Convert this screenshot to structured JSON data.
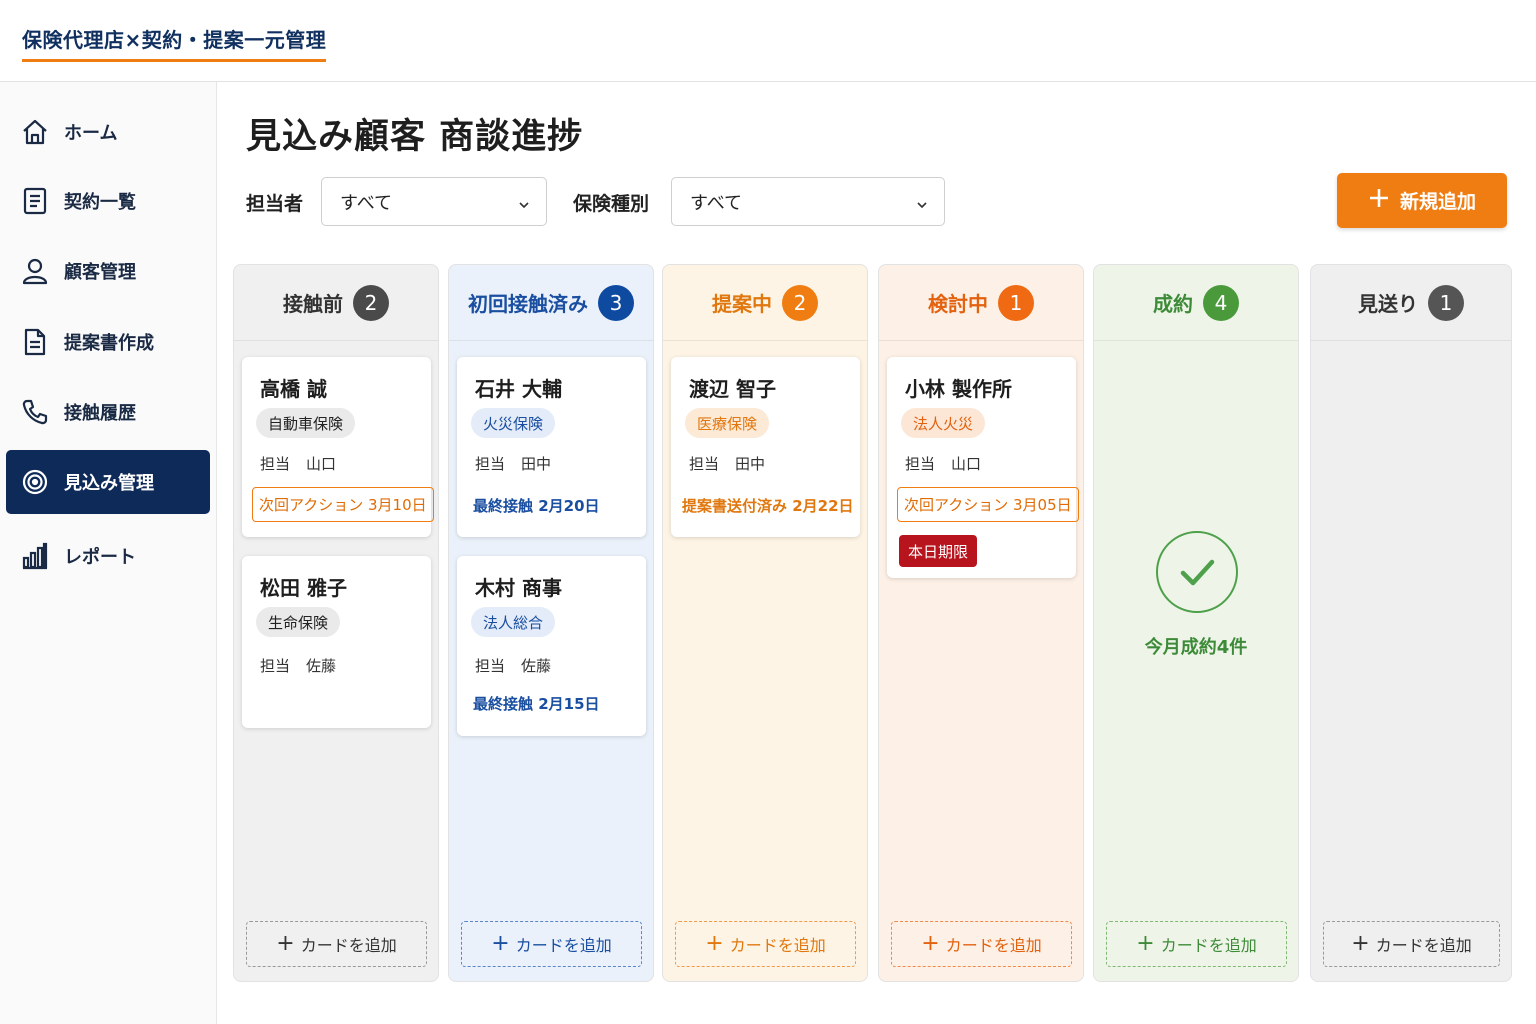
{
  "header": {
    "brand": "保険代理店×契約・提案一元管理"
  },
  "sidebar": {
    "items": [
      {
        "label": "ホーム",
        "icon": "home-icon"
      },
      {
        "label": "契約一覧",
        "icon": "document-list-icon"
      },
      {
        "label": "顧客管理",
        "icon": "user-icon"
      },
      {
        "label": "提案書作成",
        "icon": "file-text-icon"
      },
      {
        "label": "接触履歴",
        "icon": "phone-icon"
      },
      {
        "label": "見込み管理",
        "icon": "target-icon",
        "active": true
      },
      {
        "label": "レポート",
        "icon": "bar-chart-icon"
      }
    ]
  },
  "main": {
    "title": "見込み顧客 商談進捗",
    "filters": {
      "owner_label": "担当者",
      "owner_value": "すべて",
      "type_label": "保険種別",
      "type_value": "すべて"
    },
    "add_button": "新規追加",
    "add_card_label": "カードを追加",
    "columns": [
      {
        "title": "接触前",
        "count": "2",
        "badge_color": "#4a4a4a",
        "title_color": "#333333",
        "bg": "#f0f0f0",
        "cards": [
          {
            "name": "高橋 誠",
            "tag": "自動車保険",
            "owner_label": "担当",
            "owner": "山口",
            "action": "次回アクション 3月10日"
          },
          {
            "name": "松田 雅子",
            "tag": "生命保険",
            "owner_label": "担当",
            "owner": "佐藤"
          }
        ]
      },
      {
        "title": "初回接触済み",
        "count": "3",
        "badge_color": "#0d4aa0",
        "title_color": "#1a4ea0",
        "bg": "#eaf1fa",
        "cards": [
          {
            "name": "石井 大輔",
            "tag": "火災保険",
            "owner_label": "担当",
            "owner": "田中",
            "info": "最終接触 2月20日"
          },
          {
            "name": "木村 商事",
            "tag": "法人総合",
            "owner_label": "担当",
            "owner": "佐藤",
            "info": "最終接触 2月15日"
          }
        ]
      },
      {
        "title": "提案中",
        "count": "2",
        "badge_color": "#ef7d12",
        "title_color": "#e0780f",
        "bg": "#fdf4e5",
        "cards": [
          {
            "name": "渡辺 智子",
            "tag": "医療保険",
            "owner_label": "担当",
            "owner": "田中",
            "info": "提案書送付済み 2月22日"
          }
        ]
      },
      {
        "title": "検討中",
        "count": "1",
        "badge_color": "#ef6a12",
        "title_color": "#e2620f",
        "bg": "#fdf0e6",
        "cards": [
          {
            "name": "小林 製作所",
            "tag": "法人火災",
            "owner_label": "担当",
            "owner": "山口",
            "action": "次回アクション 3月05日",
            "due": "本日期限"
          }
        ]
      },
      {
        "title": "成約",
        "count": "4",
        "badge_color": "#4a9a3c",
        "title_color": "#3d8a38",
        "bg": "#eef5e8",
        "won_text": "今月成約4件"
      },
      {
        "title": "見送り",
        "count": "1",
        "badge_color": "#555555",
        "title_color": "#333333",
        "bg": "#efefef"
      }
    ]
  }
}
